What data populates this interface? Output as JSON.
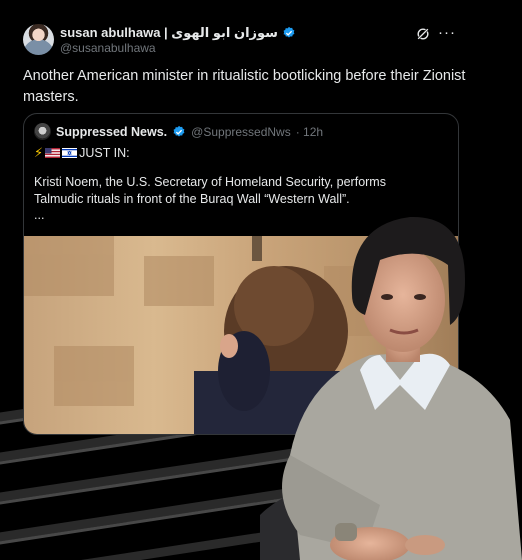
{
  "tweet": {
    "author": {
      "display_name": "susan abulhawa | سوزان ابو الهوى",
      "handle": "@susanabulhawa",
      "verified": true
    },
    "text": "Another American minister in ritualistic bootlicking before their Zionist masters."
  },
  "quoted_tweet": {
    "author": {
      "display_name": "Suppressed News.",
      "handle": "@SuppressedNws",
      "time": "· 12h",
      "verified": true
    },
    "headline_emojis": [
      "lightning",
      "us-flag",
      "israel-flag"
    ],
    "headline": "JUST IN:",
    "body": "Kristi Noem, the U.S. Secretary of Homeland Security, performs Talmudic rituals in front of the Buraq Wall “Western Wall”.",
    "ellipsis": "..."
  },
  "colors": {
    "background": "#000000",
    "text_primary": "#e7e9ea",
    "text_secondary": "#71767b",
    "verified_blue": "#1d9bf0",
    "card_border": "#333639"
  }
}
